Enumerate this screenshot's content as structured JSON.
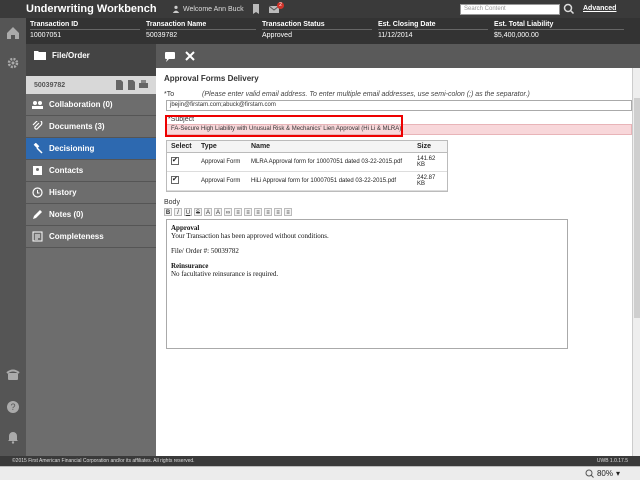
{
  "app": {
    "title": "Underwriting Workbench",
    "welcome": "Welcome Ann Buck",
    "notifications": "2",
    "search_placeholder": "Search Content",
    "advanced": "Advanced"
  },
  "info": {
    "cols": [
      {
        "head": "Transaction ID",
        "val": "10007051"
      },
      {
        "head": "Transaction Name",
        "val": "50039782"
      },
      {
        "head": "Transaction Status",
        "val": "Approved"
      },
      {
        "head": "Est. Closing Date",
        "val": "11/12/2014"
      },
      {
        "head": "Est. Total Liability",
        "val": "$5,400,000.00"
      }
    ]
  },
  "sidebar": {
    "header": "File/Order",
    "file_number": "50039782",
    "items": [
      {
        "label": "Collaboration (0)",
        "icon": "collaboration-icon"
      },
      {
        "label": "Documents (3)",
        "icon": "paperclip-icon"
      },
      {
        "label": "Decisioning",
        "icon": "gavel-icon"
      },
      {
        "label": "Contacts",
        "icon": "contacts-icon"
      },
      {
        "label": "History",
        "icon": "clock-icon"
      },
      {
        "label": "Notes (0)",
        "icon": "pencil-icon"
      },
      {
        "label": "Completeness",
        "icon": "checklist-icon"
      }
    ]
  },
  "form": {
    "title": "Approval Forms Delivery",
    "to_label": "*To",
    "to_hint": "(Please enter valid email address. To enter multiple email addresses, use semi-colon (;) as the separator.)",
    "to_value": "jbejin@firstam.com;abuck@firstam.com",
    "subject_label": "*Subject",
    "subject_value": "FA-Secure High Liability with Unusual Risk & Mechanics' Lien Approval (Hi Li & MLRA).",
    "attachments": {
      "headers": [
        "Select",
        "Type",
        "Name",
        "Size"
      ],
      "rows": [
        {
          "type": "Approval Form",
          "name": "MLRA Approval form for 10007051 dated 03-22-2015.pdf",
          "size": "141.62 KB"
        },
        {
          "type": "Approval Form",
          "name": "HiLi Approval form for 10007051 dated 03-22-2015.pdf",
          "size": "242.87 KB"
        }
      ]
    },
    "body_label": "Body",
    "body": {
      "h1": "Approval",
      "p1": "Your Transaction has been approved without conditions.",
      "p2": "File/ Order #: 50039782",
      "h2": "Reinsurance",
      "p3": "No facultative reinsurance is required."
    }
  },
  "footer": {
    "copyright": "©2015 First American Financial Corporation and/or its affiliates. All rights reserved.",
    "version": "UWB 1.0.17.5"
  },
  "status": {
    "zoom": "80%"
  }
}
